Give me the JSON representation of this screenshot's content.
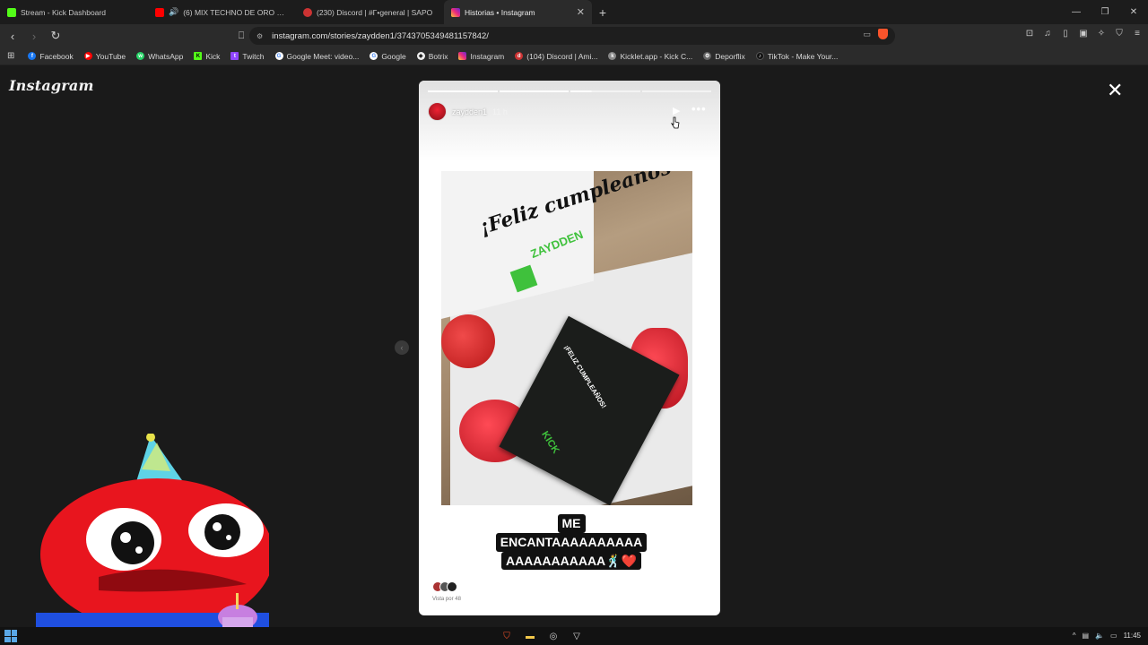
{
  "browser": {
    "tabs": [
      {
        "title": "Stream - Kick Dashboard",
        "favicon_color": "#53fc18",
        "active": false
      },
      {
        "title": "(6) MIX TECHNO DE ORO DE 80'",
        "favicon_color": "#ff0000",
        "active": false
      },
      {
        "title": "(230) Discord | #Γ•general | SAPO",
        "favicon_color": "#c33",
        "active": false
      },
      {
        "title": "Historias • Instagram",
        "favicon_color": "#d62976",
        "active": true
      }
    ],
    "new_tab_label": "+",
    "url": "instagram.com/stories/zaydden1/3743705349481157842/",
    "bookmarks": [
      {
        "label": "Facebook",
        "color": "#1877f2",
        "glyph": "f"
      },
      {
        "label": "YouTube",
        "color": "#ff0000",
        "glyph": "▶"
      },
      {
        "label": "WhatsApp",
        "color": "#25d366",
        "glyph": "w"
      },
      {
        "label": "Kick",
        "color": "#53fc18",
        "glyph": "K"
      },
      {
        "label": "Twitch",
        "color": "#9146ff",
        "glyph": "t"
      },
      {
        "label": "Google Meet: video...",
        "color": "#00897b",
        "glyph": "G"
      },
      {
        "label": "Google",
        "color": "#ffffff",
        "glyph": "G"
      },
      {
        "label": "Botrix",
        "color": "#ffffff",
        "glyph": "◆"
      },
      {
        "label": "Instagram",
        "color": "#d62976",
        "glyph": "▣"
      },
      {
        "label": "(104) Discord | Ami...",
        "color": "#c33",
        "glyph": "d"
      },
      {
        "label": "Kicklet.app - Kick C...",
        "color": "#888888",
        "glyph": "k"
      },
      {
        "label": "Deporflix",
        "color": "#bbbbbb",
        "glyph": "⚙"
      },
      {
        "label": "TikTok - Make Your...",
        "color": "#111111",
        "glyph": "♪"
      }
    ]
  },
  "instagram": {
    "logo": "Instagram",
    "close_icon": "✕",
    "story": {
      "username": "zaydden1",
      "time_ago": "11 h",
      "progress_segments": [
        1,
        1,
        0.3,
        0
      ],
      "card_lid_text": "¡Feliz cumpleaños !",
      "card_brand": "ZAYDDEN",
      "letter_text": "¡FELIZ CUMPLEAÑOS!",
      "letter_brand": "KICK",
      "caption_lines": [
        "ME",
        "ENCANTAAAAAAAAAA",
        "AAAAAAAAAAA🕺❤️"
      ],
      "seen_by": "Vista por 48"
    }
  },
  "taskbar": {
    "time": "11:45"
  }
}
